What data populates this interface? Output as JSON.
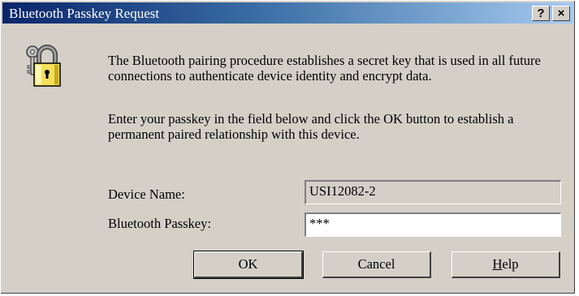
{
  "window": {
    "title": "Bluetooth Passkey Request",
    "help_button": "?",
    "close_button": "×"
  },
  "icon": "lock-keys-icon",
  "message": {
    "paragraph1": "The Bluetooth pairing procedure establishes a secret key that is used in all future connections to authenticate device identity and encrypt data.",
    "paragraph2": "Enter your passkey in the field below and click the OK button to establish a permanent paired relationship with this device."
  },
  "form": {
    "device_name_label": "Device Name:",
    "device_name_value": "USI12082-2",
    "passkey_label": "Bluetooth Passkey:",
    "passkey_value": "***"
  },
  "buttons": {
    "ok": "OK",
    "cancel": "Cancel",
    "help_mnemonic": "H",
    "help_rest": "elp"
  },
  "colors": {
    "dialog_bg": "#d4d0c8",
    "title_start": "#0a246a",
    "title_end": "#a6caf0"
  }
}
